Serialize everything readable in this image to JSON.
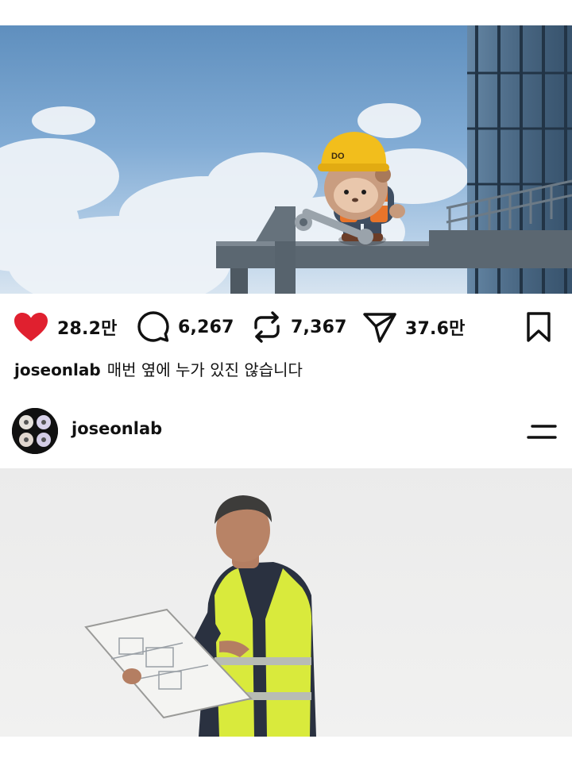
{
  "post": {
    "stats": {
      "likes": "28.2만",
      "comments": "6,267",
      "reposts": "7,367",
      "shares": "37.6만"
    },
    "caption": {
      "username": "joseonlab",
      "text": "매번 옆에 누가 있진 않습니다"
    },
    "helmet_text": "DO"
  },
  "next_post": {
    "username": "joseonlab"
  },
  "colors": {
    "like": "#e0202f",
    "text": "#111111"
  },
  "icons": {
    "like": "heart-icon",
    "comment": "comment-bubble-icon",
    "repost": "repost-icon",
    "share": "send-icon",
    "bookmark": "bookmark-icon",
    "menu": "menu-icon"
  }
}
